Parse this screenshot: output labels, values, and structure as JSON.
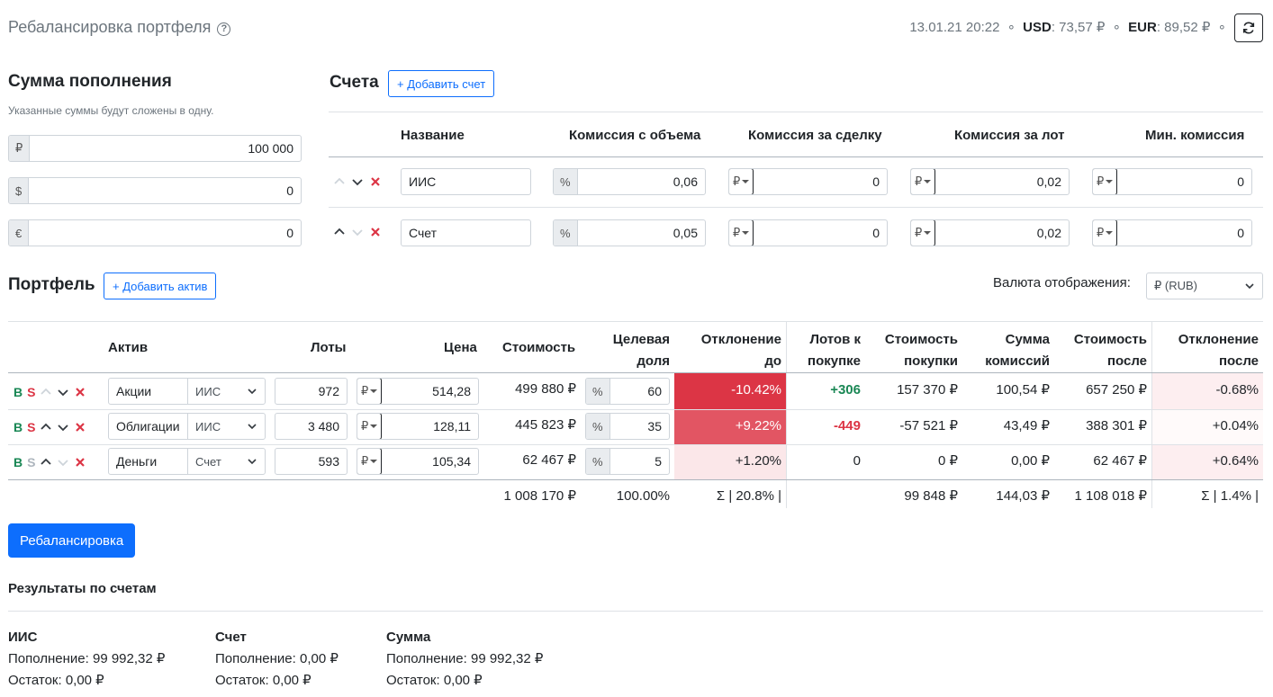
{
  "header": {
    "title": "Ребалансировка портфеля",
    "datetime": "13.01.21 20:22",
    "sep": "∘",
    "usd_label": "USD",
    "usd_value": ": 73,57 ₽",
    "eur_label": "EUR",
    "eur_value": ": 89,52 ₽"
  },
  "deposit": {
    "title": "Сумма пополнения",
    "hint": "Указанные суммы будут сложены в одну.",
    "rows": [
      {
        "currency": "₽",
        "value": "100 000"
      },
      {
        "currency": "$",
        "value": "0"
      },
      {
        "currency": "€",
        "value": "0"
      }
    ]
  },
  "accounts": {
    "title": "Счета",
    "add_label": "+ Добавить счет",
    "columns": [
      "Название",
      "Комиссия с объема",
      "Комиссия за сделку",
      "Комиссия за лот",
      "Мин. комиссия"
    ],
    "rows": [
      {
        "name": "ИИС",
        "vol_unit": "%",
        "vol": "0,06",
        "deal_unit": "₽",
        "deal": "0",
        "lot_unit": "₽",
        "lot": "0,02",
        "min_unit": "₽",
        "min": "0"
      },
      {
        "name": "Счет",
        "vol_unit": "%",
        "vol": "0,05",
        "deal_unit": "₽",
        "deal": "0",
        "lot_unit": "₽",
        "lot": "0,02",
        "min_unit": "₽",
        "min": "0"
      }
    ]
  },
  "portfolio": {
    "title": "Портфель",
    "add_label": "+ Добавить актив",
    "display_currency_label": "Валюта отображения:",
    "display_currency": "₽ (RUB)",
    "columns": {
      "asset": "Актив",
      "lots": "Лоты",
      "price": "Цена",
      "cost": "Стоимость",
      "target1": "Целевая",
      "target2": "доля",
      "dev_before1": "Отклонение",
      "dev_before2": "до",
      "lots_buy1": "Лотов к",
      "lots_buy2": "покупке",
      "buy_cost1": "Стоимость",
      "buy_cost2": "покупки",
      "commission1": "Сумма",
      "commission2": "комиссий",
      "cost_after1": "Стоимость",
      "cost_after2": "после",
      "dev_after1": "Отклонение",
      "dev_after2": "после"
    },
    "buy_letter": "B",
    "sell_letter": "S",
    "rows": [
      {
        "name": "Акции",
        "account": "ИИС",
        "lots": "972",
        "price_cur": "₽",
        "price": "514,28",
        "cost": "499 880 ₽",
        "target_unit": "%",
        "target": "60",
        "dev_before": "-10.42%",
        "lots_buy": "+306",
        "buy_cost": "157 370 ₽",
        "commission": "100,54 ₽",
        "cost_after": "657 250 ₽",
        "dev_after": "-0.68%"
      },
      {
        "name": "Облигации",
        "account": "ИИС",
        "lots": "3 480",
        "price_cur": "₽",
        "price": "128,11",
        "cost": "445 823 ₽",
        "target_unit": "%",
        "target": "35",
        "dev_before": "+9.22%",
        "lots_buy": "-449",
        "buy_cost": "-57 521 ₽",
        "commission": "43,49 ₽",
        "cost_after": "388 301 ₽",
        "dev_after": "+0.04%"
      },
      {
        "name": "Деньги",
        "account": "Счет",
        "lots": "593",
        "price_cur": "₽",
        "price": "105,34",
        "cost": "62 467 ₽",
        "target_unit": "%",
        "target": "5",
        "dev_before": "+1.20%",
        "lots_buy": "0",
        "buy_cost": "0 ₽",
        "commission": "0,00 ₽",
        "cost_after": "62 467 ₽",
        "dev_after": "+0.64%"
      }
    ],
    "totals": {
      "cost": "1 008 170 ₽",
      "target": "100.00%",
      "dev_before": "Σ | 20.8% |",
      "buy_cost": "99 848 ₽",
      "commission": "144,03 ₽",
      "cost_after": "1 108 018 ₽",
      "dev_after": "Σ | 1.4% |"
    },
    "colors": {
      "dev_strong": "#dc3545",
      "dev_medium": "#e25563",
      "dev_light": "#fbe7e9",
      "positive": "#198754",
      "negative": "#dc3545"
    }
  },
  "rebalance_label": "Ребалансировка",
  "results": {
    "title": "Результаты по счетам",
    "items": [
      {
        "name": "ИИС",
        "deposit": "Пополнение: 99 992,32 ₽",
        "rest": "Остаток: 0,00 ₽"
      },
      {
        "name": "Счет",
        "deposit": "Пополнение: 0,00 ₽",
        "rest": "Остаток: 0,00 ₽"
      },
      {
        "name": "Сумма",
        "deposit": "Пополнение: 99 992,32 ₽",
        "rest": "Остаток: 0,00 ₽"
      }
    ]
  }
}
